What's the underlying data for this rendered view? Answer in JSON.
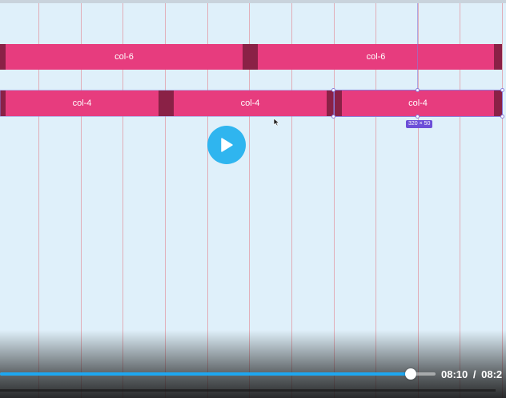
{
  "grid_columns": [
    {
      "label": "col-6"
    },
    {
      "label": "col-6"
    },
    {
      "label": "col-4"
    },
    {
      "label": "col-4"
    },
    {
      "label": "col-4"
    }
  ],
  "selection": {
    "dimension_label": "320 × 50"
  },
  "player": {
    "current_time": "08:10",
    "separator": "/",
    "duration": "08:2",
    "progress": 0.943,
    "accent_color": "#1ea7f0"
  },
  "colors": {
    "column": "#e73c7e",
    "gutter": "#8a2146",
    "background": "#dff0fa",
    "play_button": "#2fb5ef"
  },
  "icons": {
    "play": "play-icon",
    "cursor": "mouse-pointer-icon"
  }
}
